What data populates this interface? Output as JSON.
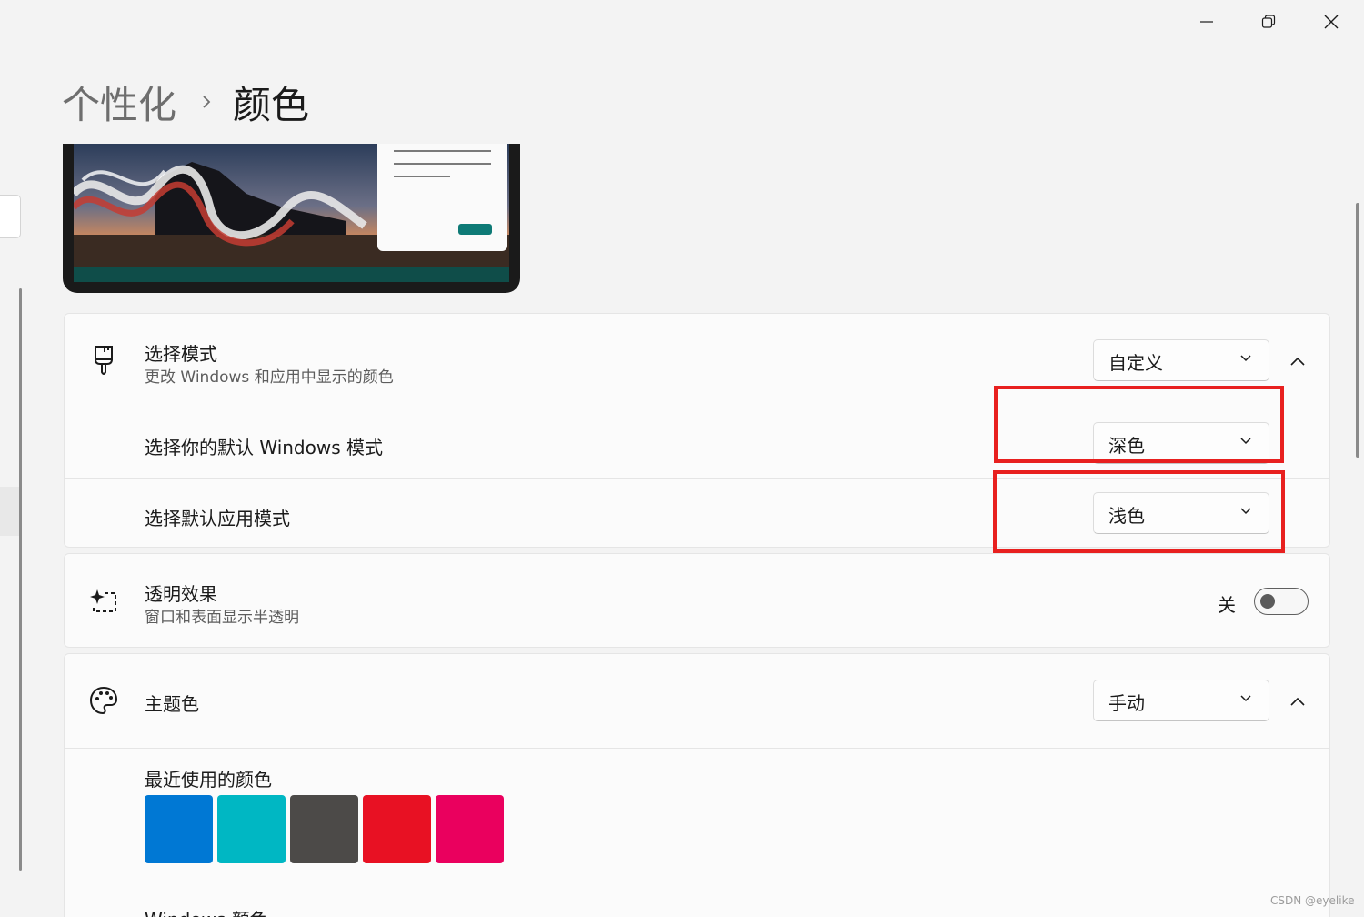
{
  "titlebar": {
    "minimize_icon": "minimize-icon",
    "maximize_icon": "restore-icon",
    "close_icon": "close-icon"
  },
  "breadcrumb": {
    "parent": "个性化",
    "separator_icon": "chevron-right-icon",
    "current": "颜色"
  },
  "mode_section": {
    "icon": "paintbrush-icon",
    "title": "选择模式",
    "description": "更改 Windows 和应用中显示的颜色",
    "value": "自定义",
    "windows_mode_label": "选择你的默认 Windows 模式",
    "windows_mode_value": "深色",
    "app_mode_label": "选择默认应用模式",
    "app_mode_value": "浅色"
  },
  "transparency": {
    "icon": "transparency-sparkle-icon",
    "title": "透明效果",
    "description": "窗口和表面显示半透明",
    "state_label": "关",
    "enabled": false
  },
  "accent": {
    "icon": "palette-icon",
    "title": "主题色",
    "value": "手动",
    "recent_label": "最近使用的颜色",
    "recent_colors": [
      "#0078d4",
      "#00b7c3",
      "#4c4a48",
      "#e81123",
      "#ea005e"
    ],
    "windows_colors_label": "Windows 颜色"
  },
  "annotation_color": "#e8201f",
  "watermark": "CSDN @eyelike"
}
